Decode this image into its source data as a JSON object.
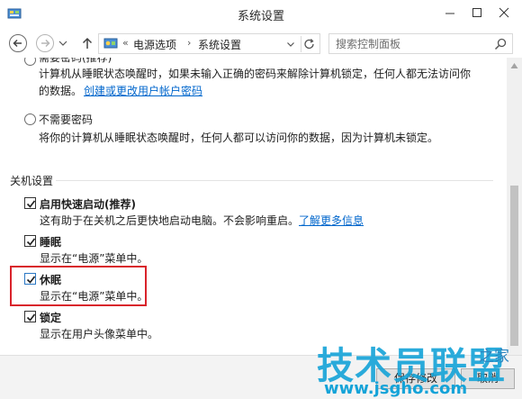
{
  "window": {
    "title": "系统设置",
    "icon": "control-panel-icon"
  },
  "nav": {
    "breadcrumb_prefix": "«",
    "crumbs": [
      "电源选项",
      "系统设置"
    ],
    "crumb_sep": "›",
    "search_placeholder": "搜索控制面板"
  },
  "password_options": {
    "require_option": {
      "label": "需要密码(推荐)",
      "line1": "计算机从睡眠状态唤醒时，如果未输入正确的密码来解除计算机锁定，任何人都无法访问你",
      "line2": "的数据。",
      "link": "创建或更改用户帐户密码"
    },
    "no_password_option": {
      "label": "不需要密码",
      "description": "将你的计算机从睡眠状态唤醒时，任何人都可以访问你的数据，因为计算机未锁定。"
    }
  },
  "shutdown_settings": {
    "section_title": "关机设置",
    "items": [
      {
        "label": "启用快速启动(推荐)",
        "checked": true,
        "description": "这有助于在关机之后更快地启动电脑。不会影响重启。",
        "link": "了解更多信息"
      },
      {
        "label": "睡眠",
        "checked": true,
        "description": "显示在“电源”菜单中。"
      },
      {
        "label": "休眠",
        "checked": true,
        "description": "显示在“电源”菜单中。",
        "highlighted": true
      },
      {
        "label": "锁定",
        "checked": true,
        "description": "显示在用户头像菜单中。"
      }
    ]
  },
  "footer": {
    "save_label": "保存修改",
    "cancel_label": "取消"
  },
  "watermark": {
    "main": "技术员联盟",
    "sub": "之家",
    "url": "www.jsgho.com"
  },
  "colors": {
    "link": "#0066cc",
    "highlight": "#d9232b",
    "watermark": "#14a3d8"
  }
}
